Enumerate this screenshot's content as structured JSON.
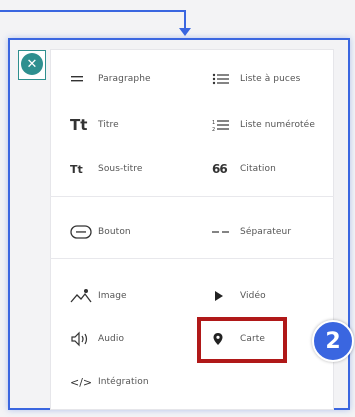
{
  "close_icon": "✕",
  "step_badge": "2",
  "left_column": [
    {
      "icon": "paragraph-icon",
      "label": "Paragraphe"
    },
    {
      "icon": "title-icon",
      "glyph": "Tt",
      "label": "Titre"
    },
    {
      "icon": "subtitle-icon",
      "glyph": "Tt",
      "label": "Sous-titre"
    },
    {
      "icon": "button-icon",
      "label": "Bouton"
    },
    {
      "icon": "image-icon",
      "label": "Image"
    },
    {
      "icon": "audio-icon",
      "label": "Audio"
    },
    {
      "icon": "embed-icon",
      "glyph": "</>",
      "label": "Intégration"
    }
  ],
  "right_column": [
    {
      "icon": "bullet-list-icon",
      "label": "Liste à puces"
    },
    {
      "icon": "numbered-list-icon",
      "label": "Liste numérotée"
    },
    {
      "icon": "quote-icon",
      "glyph": "66",
      "label": "Citation"
    },
    {
      "icon": "separator-icon",
      "label": "Séparateur"
    },
    {
      "icon": "video-icon",
      "label": "Vidéo"
    },
    {
      "icon": "map-icon",
      "label": "Carte"
    }
  ],
  "colors": {
    "accent": "#2e8f8f",
    "highlight": "#b01818",
    "badge": "#3a66e0"
  }
}
